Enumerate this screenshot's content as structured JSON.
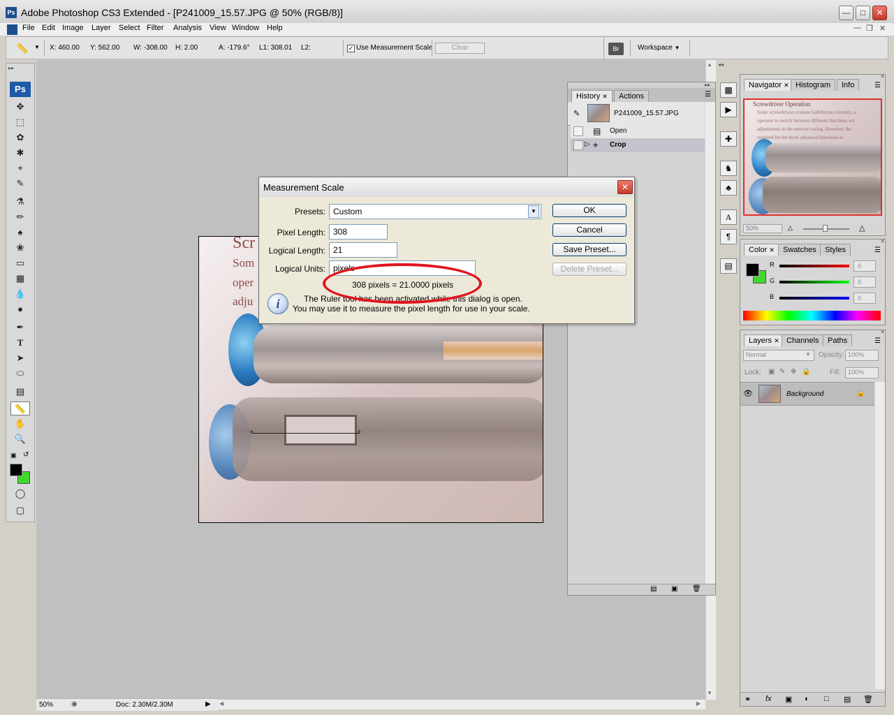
{
  "app": {
    "title": "Adobe Photoshop CS3 Extended - [P241009_15.57.JPG @ 50% (RGB/8)]",
    "logo": "Ps"
  },
  "menu": [
    "File",
    "Edit",
    "Image",
    "Layer",
    "Select",
    "Filter",
    "Analysis",
    "View",
    "Window",
    "Help"
  ],
  "options": {
    "x": "X: 460.00",
    "y": "Y: 562.00",
    "w": "W: -308.00",
    "h": "H: 2.00",
    "a": "A: -179.6°",
    "l1": "L1: 308.01",
    "l2": "L2:",
    "use_scale": "Use Measurement Scale",
    "clear": "Clear",
    "workspace": "Workspace"
  },
  "toolbox": {
    "ps": "Ps"
  },
  "document": {
    "lines": [
      "Scr",
      "Som",
      "oper",
      "adju"
    ]
  },
  "history": {
    "tabs": [
      "History",
      "Actions"
    ],
    "snapshot": "P241009_15.57.JPG",
    "items": [
      "Open",
      "Crop"
    ]
  },
  "navigator": {
    "tabs": [
      "Navigator",
      "Histogram",
      "Info"
    ],
    "zoom": "50%",
    "thumb_heading": "Screwdriver Operation",
    "thumb_lines": [
      "Sonic screwdrivers contain Gallifreyan circuitry, a",
      "operator to switch between different functions wit",
      "adjustments to the exterior casing. However, the",
      "required for the more advanced functions or"
    ]
  },
  "color": {
    "tabs": [
      "Color",
      "Swatches",
      "Styles"
    ],
    "channels": [
      {
        "label": "R",
        "value": "0"
      },
      {
        "label": "G",
        "value": "0"
      },
      {
        "label": "B",
        "value": "0"
      }
    ]
  },
  "layers": {
    "tabs": [
      "Layers",
      "Channels",
      "Paths"
    ],
    "blend": "Normal",
    "opacity_label": "Opacity:",
    "opacity": "100%",
    "lock_label": "Lock:",
    "fill_label": "Fill:",
    "fill": "100%",
    "layer_name": "Background"
  },
  "status": {
    "zoom": "50%",
    "doc": "Doc: 2.30M/2.30M"
  },
  "dialog": {
    "title": "Measurement Scale",
    "presets_label": "Presets:",
    "presets_value": "Custom",
    "pixel_length_label": "Pixel Length:",
    "pixel_length": "308",
    "logical_length_label": "Logical Length:",
    "logical_length": "21",
    "logical_units_label": "Logical Units:",
    "logical_units": "pixels",
    "equation": "308 pixels = 21.0000 pixels",
    "info1": "The Ruler tool has been activated while this dialog is open.",
    "info2": "You may use it to measure the pixel length for use in your scale.",
    "ok": "OK",
    "cancel": "Cancel",
    "save_preset": "Save Preset...",
    "delete_preset": "Delete Preset..."
  }
}
